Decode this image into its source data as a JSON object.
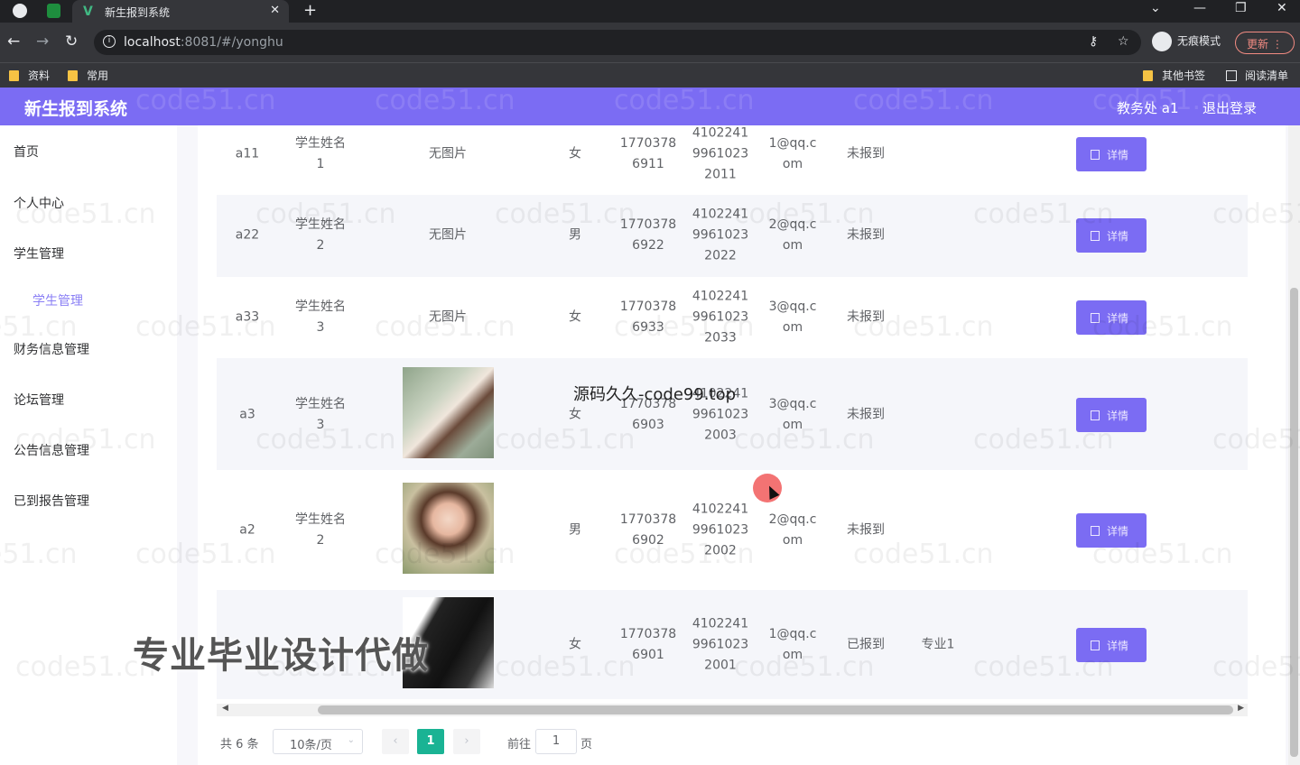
{
  "browser": {
    "tab_title": "新生报到系统",
    "tab_favicon": "V",
    "url_host": "localhost",
    "url_rest": ":8081/#/yonghu",
    "incognito_label": "无痕模式",
    "update_label": "更新",
    "bookmarks": [
      "资料",
      "常用"
    ],
    "bookmarks_right": [
      "其他书签",
      "阅读清单"
    ]
  },
  "header": {
    "title": "新生报到系统",
    "user": "教务处 a1",
    "logout": "退出登录"
  },
  "sidebar": {
    "items": [
      "首页",
      "个人中心",
      "学生管理",
      "学生管理",
      "财务信息管理",
      "论坛管理",
      "公告信息管理",
      "已到报告管理"
    ]
  },
  "table": {
    "detail_label": "详情",
    "rows": [
      {
        "account": "a11",
        "name_a": "学生姓名",
        "name_b": "1",
        "photo": "无图片",
        "gender": "女",
        "phone_a": "1770378",
        "phone_b": "6911",
        "id_a": "4102241",
        "id_b": "9961023",
        "id_c": "2011",
        "email_a": "1@qq.c",
        "email_b": "om",
        "status": "未报到",
        "major": ""
      },
      {
        "account": "a22",
        "name_a": "学生姓名",
        "name_b": "2",
        "photo": "无图片",
        "gender": "男",
        "phone_a": "1770378",
        "phone_b": "6922",
        "id_a": "4102241",
        "id_b": "9961023",
        "id_c": "2022",
        "email_a": "2@qq.c",
        "email_b": "om",
        "status": "未报到",
        "major": ""
      },
      {
        "account": "a33",
        "name_a": "学生姓名",
        "name_b": "3",
        "photo": "无图片",
        "gender": "女",
        "phone_a": "1770378",
        "phone_b": "6933",
        "id_a": "4102241",
        "id_b": "9961023",
        "id_c": "2033",
        "email_a": "3@qq.c",
        "email_b": "om",
        "status": "未报到",
        "major": ""
      },
      {
        "account": "a3",
        "name_a": "学生姓名",
        "name_b": "3",
        "photo": "",
        "gender": "女",
        "phone_a": "1770378",
        "phone_b": "6903",
        "id_a": "4102241",
        "id_b": "9961023",
        "id_c": "2003",
        "email_a": "3@qq.c",
        "email_b": "om",
        "status": "未报到",
        "major": ""
      },
      {
        "account": "a2",
        "name_a": "学生姓名",
        "name_b": "2",
        "photo": "",
        "gender": "男",
        "phone_a": "1770378",
        "phone_b": "6902",
        "id_a": "4102241",
        "id_b": "9961023",
        "id_c": "2002",
        "email_a": "2@qq.c",
        "email_b": "om",
        "status": "未报到",
        "major": ""
      },
      {
        "account": "",
        "name_a": "",
        "name_b": "",
        "photo": "",
        "gender": "女",
        "phone_a": "1770378",
        "phone_b": "6901",
        "id_a": "4102241",
        "id_b": "9961023",
        "id_c": "2001",
        "email_a": "1@qq.c",
        "email_b": "om",
        "status": "已报到",
        "major": "专业1"
      }
    ]
  },
  "pagination": {
    "total": "共 6 条",
    "page_size": "10条/页",
    "current": "1",
    "goto_prefix": "前往",
    "goto_value": "1",
    "goto_suffix": "页"
  },
  "overlays": {
    "watermark": "code51.cn",
    "promo": "专业毕业设计代做",
    "source_mark": "源码久久-code99.top"
  },
  "colors": {
    "accent": "#7b6cf3",
    "pager_active": "#1ab394"
  }
}
